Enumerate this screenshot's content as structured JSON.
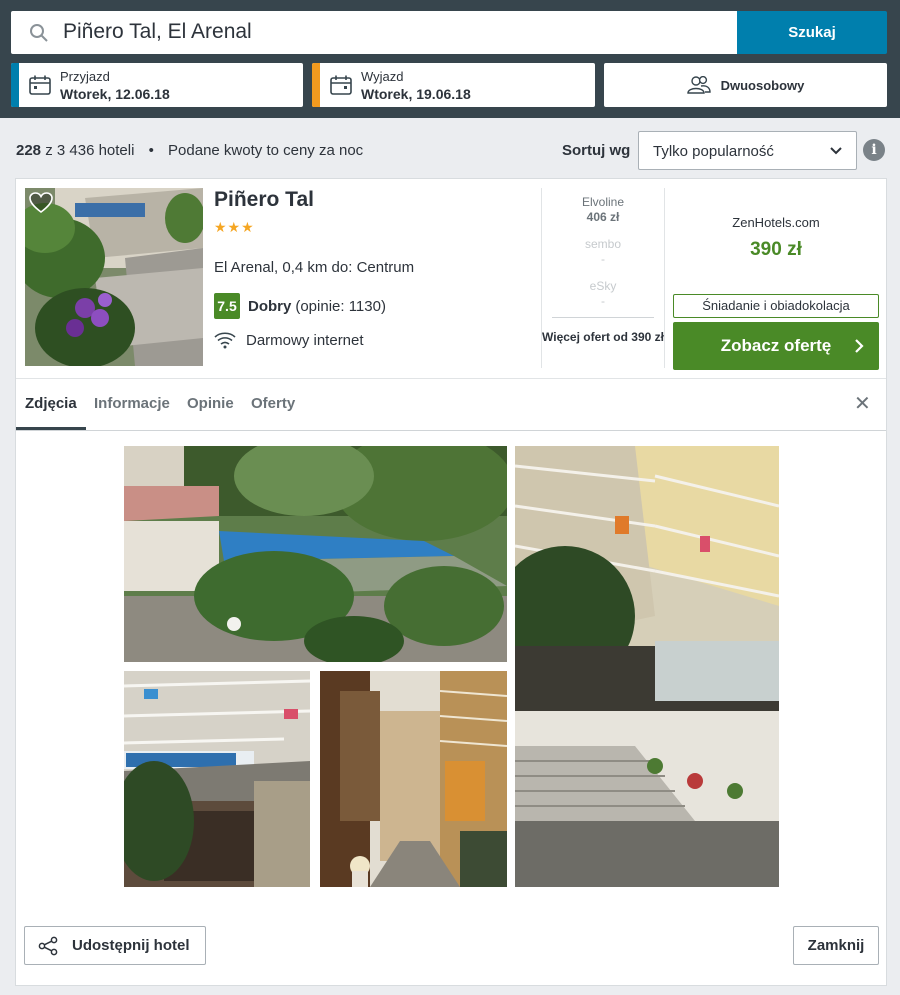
{
  "search": {
    "query": "Piñero Tal, El Arenal",
    "button_label": "Szukaj"
  },
  "checkin": {
    "label": "Przyjazd",
    "date": "Wtorek, 12.06.18",
    "accent": "#007fad"
  },
  "checkout": {
    "label": "Wyjazd",
    "date": "Wtorek, 19.06.18",
    "accent": "#f29a1f"
  },
  "room": {
    "label": "Dwuosobowy"
  },
  "results": {
    "count": "228",
    "total": "z 3 436 hoteli",
    "separator": "•",
    "note": "Podane kwoty to ceny za noc"
  },
  "sort": {
    "label": "Sortuj wg",
    "selected": "Tylko popularność"
  },
  "hotel": {
    "name": "Piñero Tal",
    "stars": "★★★",
    "star_count": 3,
    "location": "El Arenal, 0,4 km do: Centrum",
    "rating": {
      "score": "7.5",
      "label": "Dobry",
      "reviews": "(opinie: 1130)"
    },
    "amenity": "Darmowy internet",
    "deals": [
      {
        "provider": "Elvoline",
        "price": "406 zł"
      },
      {
        "provider": "sembo",
        "price": "-"
      },
      {
        "provider": "eSky",
        "price": "-"
      }
    ],
    "more_offers": "Więcej ofert od 390 zł",
    "best": {
      "provider": "ZenHotels.com",
      "price": "390 zł",
      "meal": "Śniadanie i obiadokolacja",
      "cta": "Zobacz ofertę"
    }
  },
  "tabs": [
    "Zdjęcia",
    "Informacje",
    "Opinie",
    "Oferty"
  ],
  "footer": {
    "share": "Udostępnij hotel",
    "close": "Zamknij"
  },
  "colors": {
    "header_bg": "#37454d",
    "primary_blue": "#007fad",
    "deal_green": "#4a8a27",
    "star": "#f5a623"
  }
}
